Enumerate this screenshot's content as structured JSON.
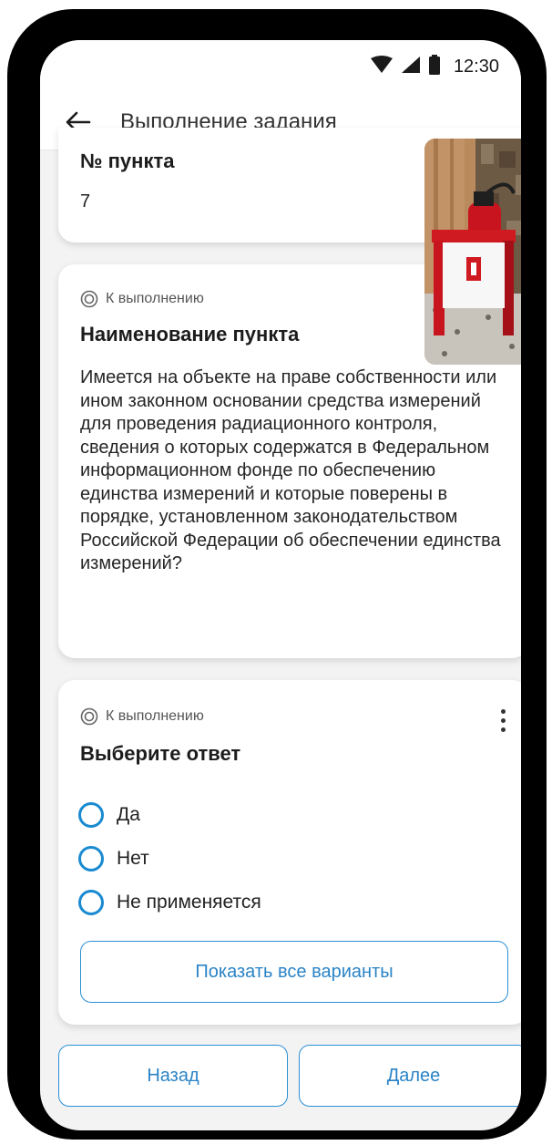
{
  "status_bar": {
    "time": "12:30"
  },
  "app_bar": {
    "title": "Выполнение задания"
  },
  "field_card": {
    "label": "№ пункта",
    "value": "7"
  },
  "item_card": {
    "status": "К выполнению",
    "heading": "Наименование пункта",
    "text": "Имеется на объекте на праве собственности или ином законном основании средства измерений для проведения радиационного контроля, сведения о которых содержатся в Федеральном информационном фонде по обеспечению единства измерений и которые поверены в порядке, установленном законодательством Российской Федерации об обеспечении единства измерений?"
  },
  "answer_card": {
    "status": "К выполнению",
    "heading": "Выберите ответ",
    "options": [
      "Да",
      "Нет",
      "Не применяется"
    ],
    "show_all_label": "Показать все варианты"
  },
  "footer": {
    "back_label": "Назад",
    "next_label": "Далее"
  },
  "colors": {
    "accent": "#1a8ad1",
    "background": "#f3f3f3",
    "card": "#ffffff"
  }
}
